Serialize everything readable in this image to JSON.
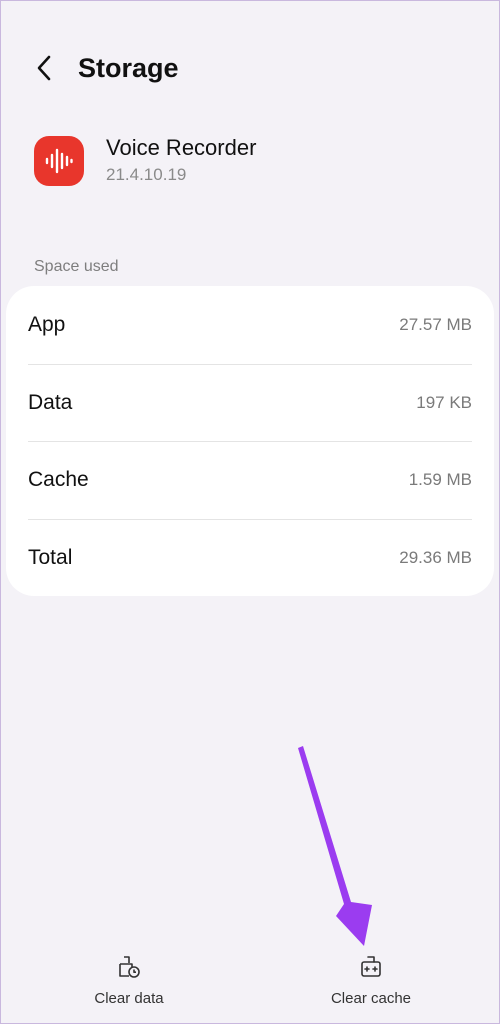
{
  "header": {
    "title": "Storage",
    "back_icon": "chevron-left-icon"
  },
  "app": {
    "name": "Voice Recorder",
    "version": "21.4.10.19",
    "icon": "voice-recorder-icon",
    "icon_color": "#e8362c"
  },
  "space_used": {
    "label": "Space used",
    "rows": [
      {
        "label": "App",
        "value": "27.57 MB"
      },
      {
        "label": "Data",
        "value": "197 KB"
      },
      {
        "label": "Cache",
        "value": "1.59 MB"
      },
      {
        "label": "Total",
        "value": "29.36 MB"
      }
    ]
  },
  "bottom_actions": {
    "clear_data": {
      "label": "Clear data",
      "icon": "clear-data-icon"
    },
    "clear_cache": {
      "label": "Clear cache",
      "icon": "clear-cache-icon"
    }
  },
  "annotation": {
    "arrow_color": "#9b3cf0"
  }
}
